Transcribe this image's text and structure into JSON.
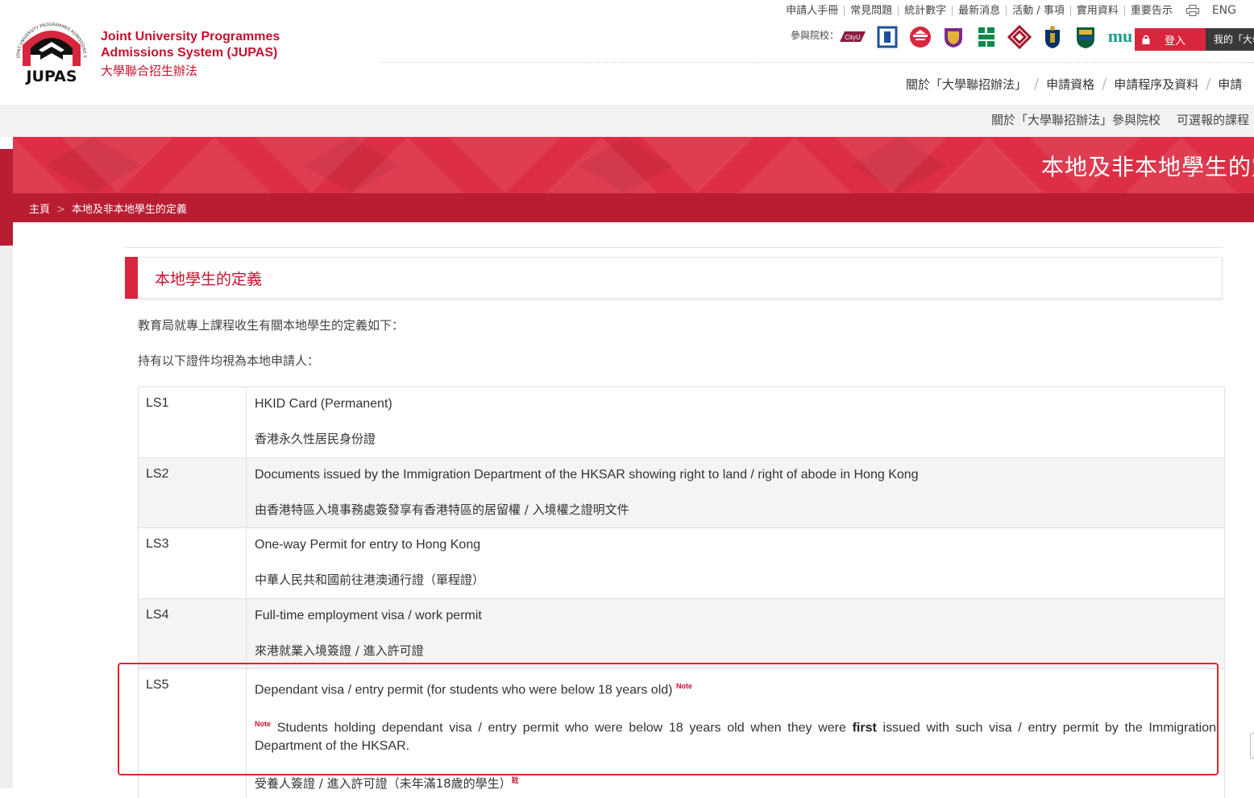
{
  "header": {
    "logo_word": "JUPAS",
    "logo_arc": "JOINT UNIVERSITY PROGRAMMES ADMISSIONS SYSTEM",
    "title_en_line1": "Joint University Programmes",
    "title_en_line2": "Admissions System (JUPAS)",
    "title_zh": "大學聯合招生辦法",
    "top_links": [
      "申請人手冊",
      "常見問題",
      "統計數字",
      "最新消息",
      "活動 / 事項",
      "實用資料",
      "重要告示"
    ],
    "lang": "ENG",
    "partners_label": "參與院校：",
    "partners": [
      "cityu-logo",
      "hkbu-logo",
      "lingnan-logo",
      "cuhk-logo",
      "eduhk-logo",
      "polyu-logo",
      "hkust-logo",
      "hku-logo",
      "mu-logo"
    ],
    "partner_cityu_text": "CityU",
    "partner_mu_text": "mu",
    "login_label": "登入",
    "my_label": "我的「大學",
    "main_nav": [
      "關於「大學聯招辦法」",
      "申請資格",
      "申請程序及資料",
      "申請"
    ]
  },
  "subnav": [
    "關於「大學聯招辦法」參與院校",
    "可選報的課程"
  ],
  "banner": {
    "title": "本地及非本地學生的定義",
    "breadcrumb_home": "主頁",
    "breadcrumb_sep": ">",
    "breadcrumb_current": "本地及非本地學生的定義"
  },
  "section": {
    "title": "本地學生的定義",
    "intro1": "教育局就專上課程收生有關本地學生的定義如下：",
    "intro2": "持有以下證件均視為本地申請人："
  },
  "rows": [
    {
      "code": "LS1",
      "en": "HKID Card (Permanent)",
      "zh": "香港永久性居民身份證"
    },
    {
      "code": "LS2",
      "en": "Documents issued by the Immigration Department of the HKSAR showing right to land / right of abode in Hong Kong",
      "zh": "由香港特區入境事務處簽發享有香港特區的居留權 / 入境權之證明文件"
    },
    {
      "code": "LS3",
      "en": "One-way Permit for entry to Hong Kong",
      "zh": "中華人民共和國前往港澳通行證（單程證）"
    },
    {
      "code": "LS4",
      "en": "Full-time employment visa / work permit",
      "zh": "來港就業入境簽證 / 進入許可證"
    },
    {
      "code": "LS5",
      "en": "Dependant visa / entry permit (for students who were below 18 years old)",
      "note_mark": "Note",
      "note_pre": "Students holding dependant visa / entry permit who were below 18 years old when they were ",
      "note_bold": "first",
      "note_post": " issued with such visa / entry permit by the Immigration Department of the HKSAR.",
      "zh": "受養人簽證 / 進入許可證（未年滿18歲的學生）",
      "zh_mark": "註"
    }
  ],
  "colors": {
    "brand_red": "#c8102e",
    "banner_red": "#dc2f45",
    "crumb_red": "#b81d32",
    "highlight": "#e0242f"
  }
}
